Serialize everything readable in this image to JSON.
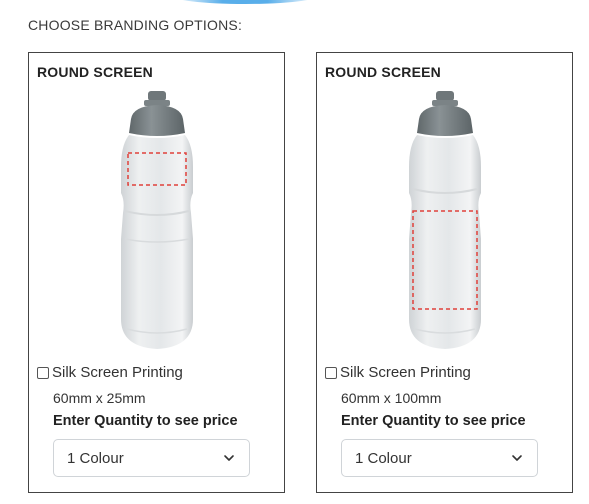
{
  "section_title": "CHOOSE BRANDING OPTIONS:",
  "cards": [
    {
      "title": "ROUND SCREEN",
      "option_label": "Silk Screen Printing",
      "dimensions": "60mm x 25mm",
      "price_note": "Enter Quantity to see price",
      "select_value": "1 Colour",
      "print_area": "small-band"
    },
    {
      "title": "ROUND SCREEN",
      "option_label": "Silk Screen Printing",
      "dimensions": "60mm x 100mm",
      "price_note": "Enter Quantity to see price",
      "select_value": "1 Colour",
      "print_area": "large-panel"
    }
  ],
  "colors": {
    "print_area_outline": "#e0413b",
    "bottle_cap": "#7d8588",
    "card_border": "#444444"
  },
  "icons": {
    "select_chevron": "chevron-down-icon",
    "checkbox": "checkbox-icon"
  }
}
